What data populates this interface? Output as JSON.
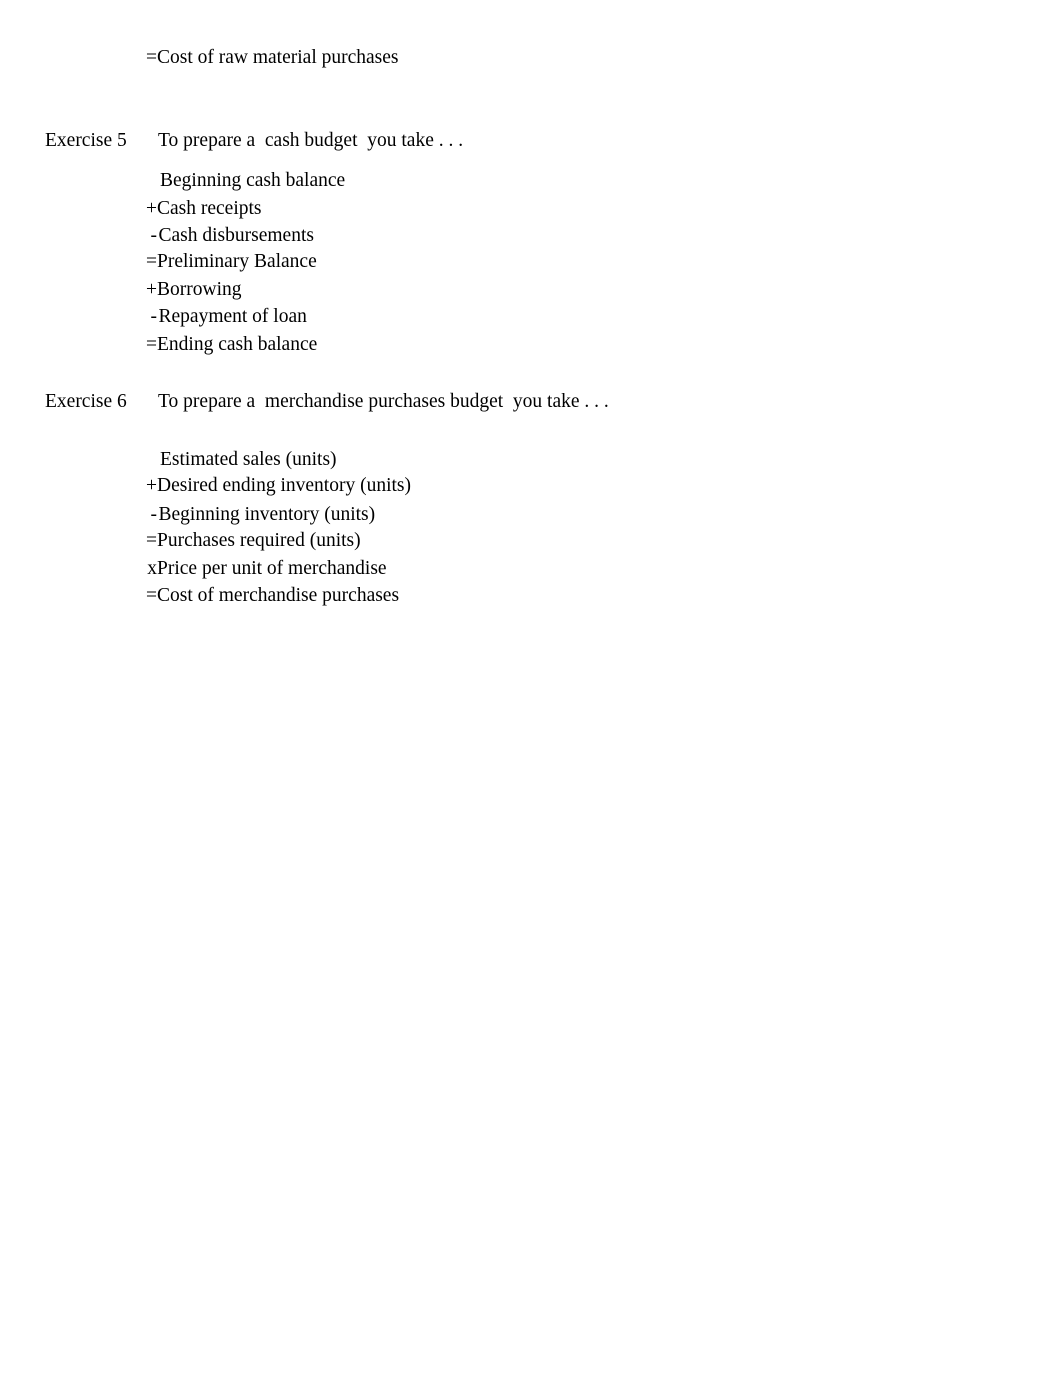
{
  "document": {
    "background_color": "#ffffff",
    "text_color": "#000000"
  },
  "orphan_line": {
    "operator": "=",
    "term": "Cost of raw material purchases"
  },
  "exercises": [
    {
      "label": "Exercise 5",
      "description": "To prepare a  cash budget  you take . . .",
      "lines": [
        {
          "operator": "",
          "term": "Beginning cash balance"
        },
        {
          "operator": "+",
          "term": "Cash receipts"
        },
        {
          "operator": "-",
          "term": "Cash disbursements"
        },
        {
          "operator": "=",
          "term": "Preliminary Balance"
        },
        {
          "operator": "+",
          "term": "Borrowing"
        },
        {
          "operator": "-",
          "term": "Repayment of loan"
        },
        {
          "operator": "=",
          "term": "Ending cash balance"
        }
      ]
    },
    {
      "label": "Exercise 6",
      "description": "To prepare a  merchandise purchases budget  you take . . .",
      "lines": [
        {
          "operator": "",
          "term": "Estimated sales (units)"
        },
        {
          "operator": "+",
          "term": "Desired ending inventory (units)"
        },
        {
          "operator": "-",
          "term": "Beginning inventory (units)"
        },
        {
          "operator": "=",
          "term": "Purchases required (units)"
        },
        {
          "operator": "x",
          "term": "Price per unit of merchandise"
        },
        {
          "operator": "=",
          "term": "Cost of merchandise purchases"
        }
      ]
    }
  ]
}
